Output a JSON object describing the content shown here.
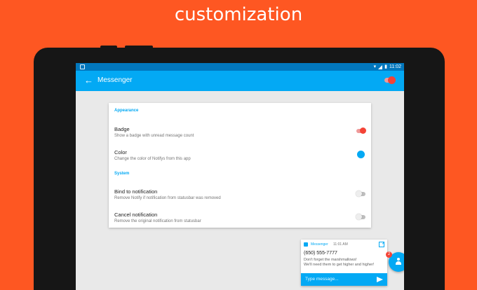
{
  "headline": "customization",
  "statusbar": {
    "time": "11:02"
  },
  "appbar": {
    "title": "Messenger",
    "master_enabled": true
  },
  "sections": {
    "appearance": "Appearance",
    "system": "System"
  },
  "settings": {
    "badge": {
      "title": "Badge",
      "summary": "Show a badge with unread message count",
      "enabled": true
    },
    "color": {
      "title": "Color",
      "summary": "Change the color of Notifys from this app",
      "value": "#03a9f4"
    },
    "bind": {
      "title": "Bind to notification",
      "summary": "Remove Notify if notification from statusbar was removed",
      "enabled": false
    },
    "cancel": {
      "title": "Cancel notification",
      "summary": "Remove the original notification from statusbar",
      "enabled": false
    }
  },
  "notification": {
    "app": "Messenger",
    "time": "11:01 AM",
    "sender": "(650) 555-7777",
    "message": "Don't forget the marshmallows!\nWe'll need them to get higher and higher!",
    "reply_placeholder": "Type message..."
  },
  "chat_head": {
    "badge_count": "2"
  },
  "colors": {
    "accent": "#03a9f4",
    "primary_dark": "#0277bd",
    "switch_on": "#f44336",
    "background": "#fe5722"
  }
}
